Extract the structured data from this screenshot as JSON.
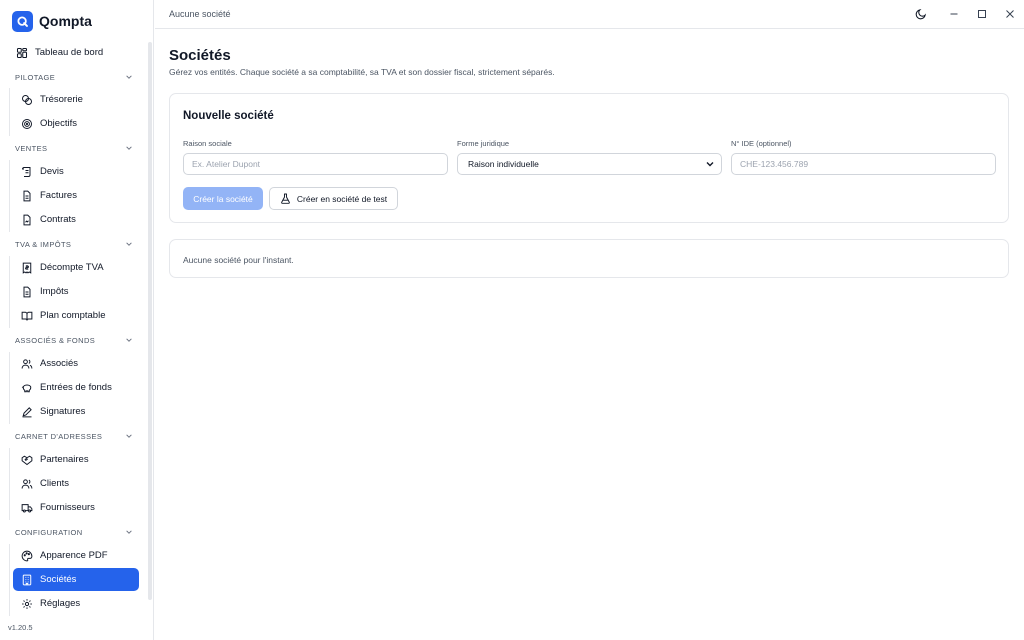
{
  "app": {
    "name": "Qompta",
    "version": "v1.20.5"
  },
  "topbar": {
    "company": "Aucune société"
  },
  "sidebar": {
    "dashboard": "Tableau de bord",
    "sections": [
      {
        "title": "PILOTAGE",
        "items": [
          "Trésorerie",
          "Objectifs"
        ]
      },
      {
        "title": "VENTES",
        "items": [
          "Devis",
          "Factures",
          "Contrats"
        ]
      },
      {
        "title": "TVA & IMPÔTS",
        "items": [
          "Décompte TVA",
          "Impôts",
          "Plan comptable"
        ]
      },
      {
        "title": "ASSOCIÉS & FONDS",
        "items": [
          "Associés",
          "Entrées de fonds",
          "Signatures"
        ]
      },
      {
        "title": "CARNET D'ADRESSES",
        "items": [
          "Partenaires",
          "Clients",
          "Fournisseurs"
        ]
      },
      {
        "title": "CONFIGURATION",
        "items": [
          "Apparence PDF",
          "Sociétés",
          "Réglages"
        ]
      }
    ],
    "active": "Sociétés"
  },
  "page": {
    "title": "Sociétés",
    "subtitle": "Gérez vos entités. Chaque société a sa comptabilité, sa TVA et son dossier fiscal, strictement séparés."
  },
  "form": {
    "title": "Nouvelle société",
    "name_label": "Raison sociale",
    "name_placeholder": "Ex. Atelier Dupont",
    "legal_label": "Forme juridique",
    "legal_value": "Raison individuelle",
    "ide_label": "N° IDE (optionnel)",
    "ide_placeholder": "CHE-123.456.789",
    "create_label": "Créer la société",
    "create_test_label": "Créer en société de test"
  },
  "empty": {
    "text": "Aucune société pour l'instant."
  },
  "colors": {
    "accent": "#2563eb",
    "accent_disabled": "#93b4f6"
  }
}
